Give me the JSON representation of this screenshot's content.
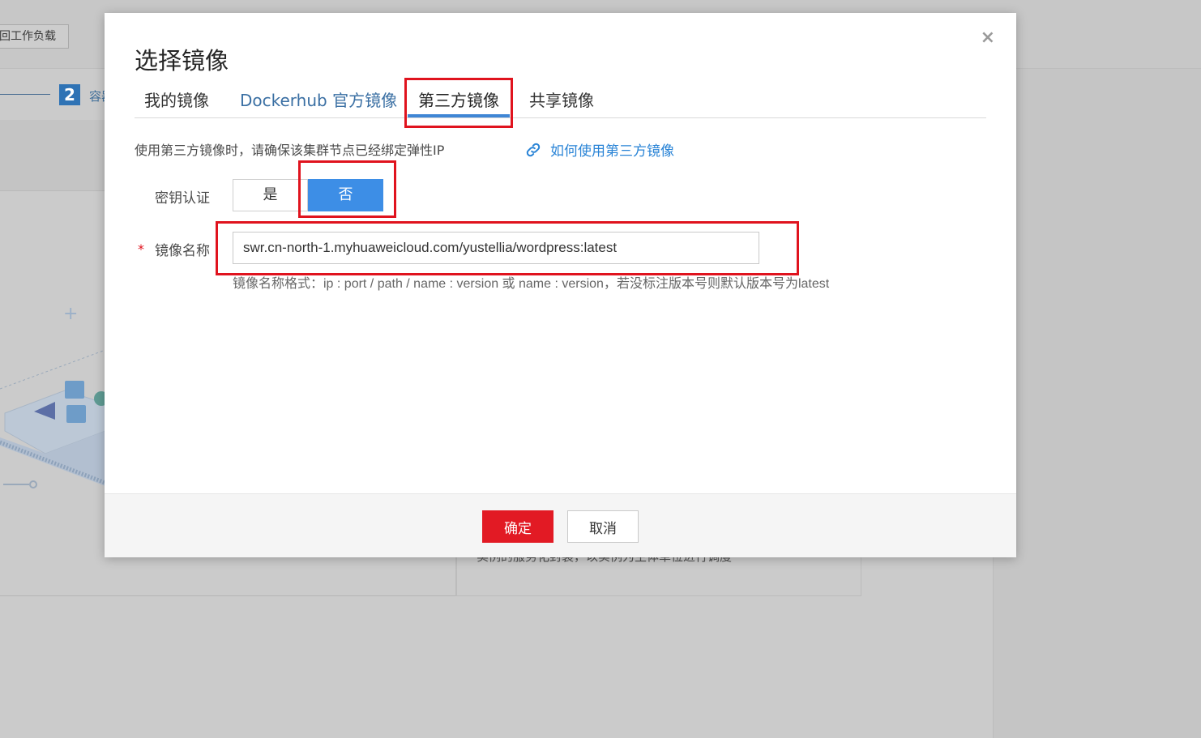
{
  "background": {
    "back_button": "回工作负载",
    "step_number": "2",
    "step_text": "容器",
    "card_text": "实例的服务化封装，以实例为主体单位进行调度"
  },
  "dialog": {
    "title": "选择镜像",
    "close": "×",
    "tabs": [
      {
        "label": "我的镜像"
      },
      {
        "label": "Dockerhub 官方镜像"
      },
      {
        "label": "第三方镜像"
      },
      {
        "label": "共享镜像"
      }
    ],
    "active_tab": "第三方镜像",
    "notice": "使用第三方镜像时，请确保该集群节点已经绑定弹性IP",
    "help_link": "如何使用第三方镜像",
    "auth": {
      "label": "密钥认证",
      "options": [
        "是",
        "否"
      ],
      "selected": "否"
    },
    "image_name": {
      "required_mark": "*",
      "label": "镜像名称",
      "value": "swr.cn-north-1.myhuaweicloud.com/yustellia/wordpress:latest",
      "hint": "镜像名称格式：ip : port / path / name : version 或 name : version，若没标注版本号则默认版本号为latest"
    },
    "buttons": {
      "confirm": "确定",
      "cancel": "取消"
    }
  },
  "colors": {
    "primary_red": "#e21a24",
    "highlight_red": "#e0131e",
    "active_blue": "#3d8ee6",
    "link_blue": "#2a84d6"
  }
}
